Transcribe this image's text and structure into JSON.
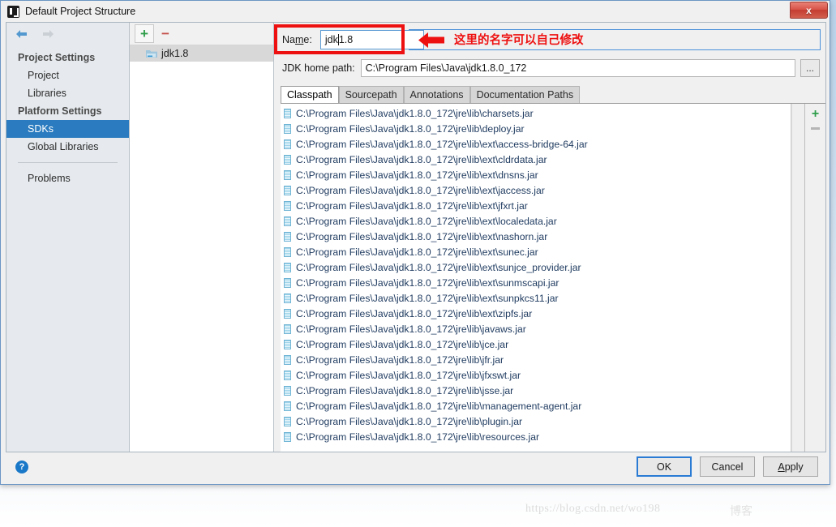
{
  "window": {
    "title": "Default Project Structure",
    "close_label": "x",
    "app_icon": "intellij-idea-icon"
  },
  "sidebar": {
    "back_icon": "back-arrow-icon",
    "forward_icon": "forward-arrow-icon",
    "groups": [
      {
        "label": "Project Settings",
        "items": [
          {
            "label": "Project",
            "selected": false
          },
          {
            "label": "Libraries",
            "selected": false
          }
        ]
      },
      {
        "label": "Platform Settings",
        "items": [
          {
            "label": "SDKs",
            "selected": true
          },
          {
            "label": "Global Libraries",
            "selected": false
          }
        ]
      }
    ],
    "extra": [
      {
        "label": "Problems",
        "selected": false
      }
    ]
  },
  "sdk_panel": {
    "add_label": "+",
    "remove_label": "−",
    "items": [
      {
        "label": "jdk1.8",
        "selected": true
      }
    ]
  },
  "detail": {
    "name_label_pre": "Na",
    "name_label_mnemonic": "m",
    "name_label_post": "e:",
    "name_value_pre": "jdk",
    "name_value_post": "1.8",
    "jdk_home_label": "JDK home path:",
    "jdk_home_value": "C:\\Program Files\\Java\\jdk1.8.0_172",
    "browse_label": "...",
    "tabs": [
      {
        "label": "Classpath",
        "active": true
      },
      {
        "label": "Sourcepath",
        "active": false
      },
      {
        "label": "Annotations",
        "active": false
      },
      {
        "label": "Documentation Paths",
        "active": false
      }
    ],
    "classpath_add": "+",
    "classpath_remove": "−",
    "classpath_entries": [
      "C:\\Program Files\\Java\\jdk1.8.0_172\\jre\\lib\\charsets.jar",
      "C:\\Program Files\\Java\\jdk1.8.0_172\\jre\\lib\\deploy.jar",
      "C:\\Program Files\\Java\\jdk1.8.0_172\\jre\\lib\\ext\\access-bridge-64.jar",
      "C:\\Program Files\\Java\\jdk1.8.0_172\\jre\\lib\\ext\\cldrdata.jar",
      "C:\\Program Files\\Java\\jdk1.8.0_172\\jre\\lib\\ext\\dnsns.jar",
      "C:\\Program Files\\Java\\jdk1.8.0_172\\jre\\lib\\ext\\jaccess.jar",
      "C:\\Program Files\\Java\\jdk1.8.0_172\\jre\\lib\\ext\\jfxrt.jar",
      "C:\\Program Files\\Java\\jdk1.8.0_172\\jre\\lib\\ext\\localedata.jar",
      "C:\\Program Files\\Java\\jdk1.8.0_172\\jre\\lib\\ext\\nashorn.jar",
      "C:\\Program Files\\Java\\jdk1.8.0_172\\jre\\lib\\ext\\sunec.jar",
      "C:\\Program Files\\Java\\jdk1.8.0_172\\jre\\lib\\ext\\sunjce_provider.jar",
      "C:\\Program Files\\Java\\jdk1.8.0_172\\jre\\lib\\ext\\sunmscapi.jar",
      "C:\\Program Files\\Java\\jdk1.8.0_172\\jre\\lib\\ext\\sunpkcs11.jar",
      "C:\\Program Files\\Java\\jdk1.8.0_172\\jre\\lib\\ext\\zipfs.jar",
      "C:\\Program Files\\Java\\jdk1.8.0_172\\jre\\lib\\javaws.jar",
      "C:\\Program Files\\Java\\jdk1.8.0_172\\jre\\lib\\jce.jar",
      "C:\\Program Files\\Java\\jdk1.8.0_172\\jre\\lib\\jfr.jar",
      "C:\\Program Files\\Java\\jdk1.8.0_172\\jre\\lib\\jfxswt.jar",
      "C:\\Program Files\\Java\\jdk1.8.0_172\\jre\\lib\\jsse.jar",
      "C:\\Program Files\\Java\\jdk1.8.0_172\\jre\\lib\\management-agent.jar",
      "C:\\Program Files\\Java\\jdk1.8.0_172\\jre\\lib\\plugin.jar",
      "C:\\Program Files\\Java\\jdk1.8.0_172\\jre\\lib\\resources.jar"
    ]
  },
  "annotation": {
    "note_text": "这里的名字可以自己修改",
    "arrow_icon": "left-arrow-annotation-icon",
    "highlight_color": "#ee1111"
  },
  "footer": {
    "help_label": "?",
    "ok_label": "OK",
    "cancel_label": "Cancel",
    "apply_label_mnemonic": "A",
    "apply_label_rest": "pply"
  },
  "watermark": {
    "url": "https://blog.csdn.net/wo198",
    "brand": "博客"
  }
}
